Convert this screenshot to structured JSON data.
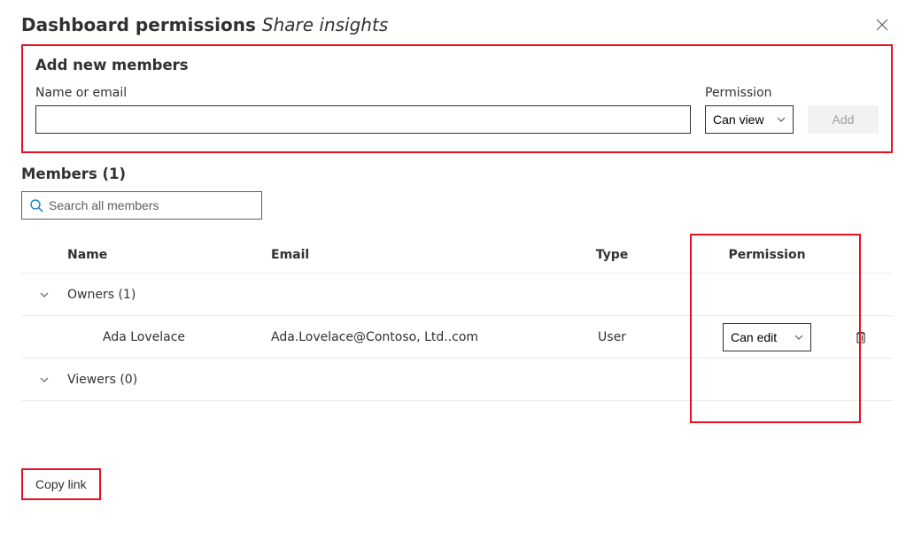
{
  "header": {
    "title_prefix": "Dashboard permissions ",
    "title_suffix": "Share insights"
  },
  "addNew": {
    "section_title": "Add new members",
    "name_label": "Name or email",
    "perm_label": "Permission",
    "perm_selected": "Can view",
    "add_label": "Add"
  },
  "members": {
    "header": "Members (1)",
    "search_placeholder": "Search all members"
  },
  "columns": {
    "name": "Name",
    "email": "Email",
    "type": "Type",
    "permission": "Permission"
  },
  "groups": {
    "owners_label": "Owners (1)",
    "viewers_label": "Viewers (0)"
  },
  "rows": [
    {
      "name": "Ada Lovelace",
      "email": "Ada.Lovelace@Contoso, Ltd..com",
      "type": "User",
      "permission": "Can edit"
    }
  ],
  "footer": {
    "copy_link": "Copy link"
  }
}
